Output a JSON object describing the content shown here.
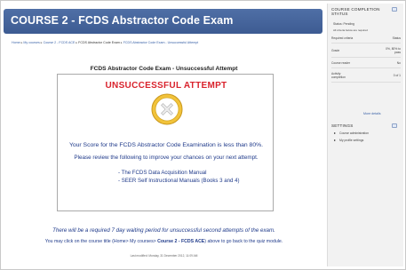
{
  "header": {
    "title": "COURSE 2 - FCDS Abstractor Code Exam"
  },
  "breadcrumb": {
    "items": [
      "Home",
      "My courses",
      "Course 2 - FCDS ACE",
      "FCDS Abstractor Code Exam",
      "FCDS Abstractor Code Exam - Unsuccessful Attempt"
    ],
    "separator": "▸"
  },
  "main": {
    "page_title": "FCDS Abstractor Code Exam - Unsuccessful Attempt",
    "box": {
      "heading": "UNSUCCESSFUL ATTEMPT",
      "icon": "fail-x-icon",
      "score_text": "Your Score for the FCDS Abstractor Code Examination is less than 80%.",
      "review_text": "Please review the following to improve your chances on your next attempt.",
      "manuals": [
        "- The FCDS Data Acquisition Manual",
        "- SEER Self Instructional Manuals (Books 3 and 4)"
      ]
    },
    "wait_text": "There will be a required 7 day waiting period for unsuccessful second attempts of the exam.",
    "click_prefix": "You may click on the course title (Home> My courses> ",
    "click_link": "Course 2 - FCDS ACE",
    "click_suffix": ") above to go back to the quiz module.",
    "last_modified": "Last modified: Monday, 31 December 2012, 11:09 AM"
  },
  "sidebar": {
    "completion": {
      "title_line1": "COURSE COMPLETION",
      "title_line2": "STATUS",
      "status": "Status: Pending",
      "criteria_note": "All criteria below are required",
      "required_label": "Required criteria",
      "required_value": "Status",
      "rows": [
        {
          "label": "Grade",
          "value": "0%, 80% to pass"
        },
        {
          "label": "Course reader",
          "value": "No"
        },
        {
          "label": "Activity completion",
          "value": "0 of 1"
        }
      ],
      "more_details": "More details"
    },
    "settings": {
      "title": "SETTINGS",
      "items": [
        "Course administration",
        "My profile settings"
      ]
    }
  },
  "colors": {
    "header_bg": "#4a69a0",
    "heading_red": "#d9232d",
    "text_blue": "#1f3a8a",
    "link_blue": "#3b63a8",
    "icon_yellow": "#f2c33a",
    "icon_white": "#ffffff",
    "icon_cross": "#ececec"
  }
}
